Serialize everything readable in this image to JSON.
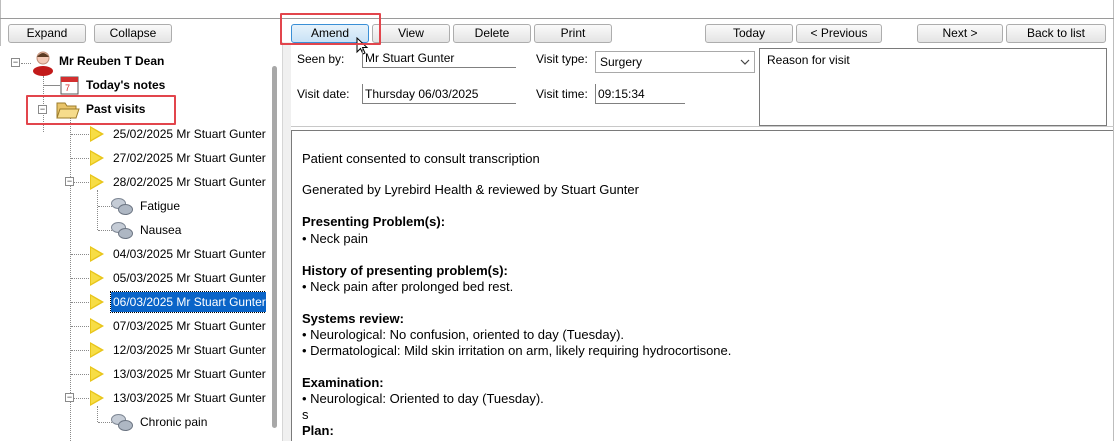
{
  "toolbar": {
    "expand": "Expand",
    "collapse": "Collapse",
    "amend": "Amend",
    "view": "View",
    "delete": "Delete",
    "print": "Print",
    "today": "Today",
    "previous": "< Previous",
    "next": "Next >",
    "back_to_list": "Back to list"
  },
  "tree": {
    "patient": "Mr Reuben T Dean",
    "todays_notes": "Today's notes",
    "past_visits": "Past visits",
    "visits": [
      {
        "label": "25/02/2025  Mr Stuart Gunter"
      },
      {
        "label": "27/02/2025  Mr Stuart Gunter"
      },
      {
        "label": "28/02/2025  Mr Stuart Gunter",
        "children": [
          "Fatigue",
          "Nausea"
        ]
      },
      {
        "label": "04/03/2025  Mr Stuart Gunter"
      },
      {
        "label": "05/03/2025  Mr Stuart Gunter"
      },
      {
        "label": "06/03/2025  Mr Stuart Gunter",
        "selected": true
      },
      {
        "label": "07/03/2025  Mr Stuart Gunter"
      },
      {
        "label": "12/03/2025  Mr Stuart Gunter"
      },
      {
        "label": "13/03/2025  Mr Stuart Gunter"
      },
      {
        "label": "13/03/2025  Mr Stuart Gunter",
        "children": [
          "Chronic pain"
        ]
      }
    ]
  },
  "visit": {
    "seen_by_label": "Seen by:",
    "seen_by_value": "Mr Stuart Gunter",
    "visit_type_label": "Visit type:",
    "visit_type_value": "Surgery",
    "visit_date_label": "Visit date:",
    "visit_date_value": "Thursday 06/03/2025",
    "visit_time_label": "Visit time:",
    "visit_time_value": "09:15:34",
    "reason_placeholder": "Reason for visit"
  },
  "notes": {
    "consent": "Patient consented to consult transcription",
    "generated": "Generated by Lyrebird Health & reviewed by Stuart Gunter",
    "presenting_heading": "Presenting Problem(s):",
    "presenting_1": "• Neck pain",
    "history_heading": "History of presenting problem(s):",
    "history_1": "• Neck pain after prolonged bed rest.",
    "systems_heading": "Systems review:",
    "systems_1": "• Neurological: No confusion, oriented to day (Tuesday).",
    "systems_2": "• Dermatological: Mild skin irritation on arm, likely requiring hydrocortisone.",
    "exam_heading": "Examination:",
    "exam_1": "• Neurological: Oriented to day (Tuesday).",
    "exam_2": "s",
    "plan_heading": "Plan:"
  },
  "colors": {
    "highlight_box": "#e2454c",
    "selection": "#0a64c8",
    "visit_icon": "#e8c51a"
  }
}
